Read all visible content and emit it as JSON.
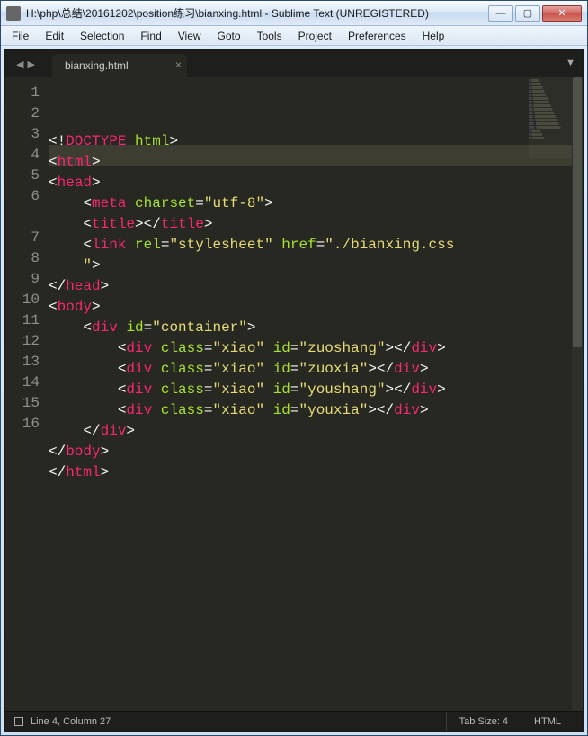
{
  "window": {
    "title": "H:\\php\\总结\\20161202\\position练习\\bianxing.html - Sublime Text (UNREGISTERED)"
  },
  "menu": {
    "items": [
      "File",
      "Edit",
      "Selection",
      "Find",
      "View",
      "Goto",
      "Tools",
      "Project",
      "Preferences",
      "Help"
    ]
  },
  "tabs": {
    "nav_back": "◀",
    "nav_fwd": "▶",
    "dropdown": "▼",
    "active": {
      "label": "bianxing.html",
      "close": "×"
    }
  },
  "editor": {
    "highlight_line": 4,
    "lines": [
      [
        {
          "t": "<!",
          "c": "p"
        },
        {
          "t": "DOCTYPE",
          "c": "tg"
        },
        {
          "t": " ",
          "c": "p"
        },
        {
          "t": "html",
          "c": "attr"
        },
        {
          "t": ">",
          "c": "p"
        }
      ],
      [
        {
          "t": "<",
          "c": "p"
        },
        {
          "t": "html",
          "c": "tg"
        },
        {
          "t": ">",
          "c": "p"
        }
      ],
      [
        {
          "t": "<",
          "c": "p"
        },
        {
          "t": "head",
          "c": "tg"
        },
        {
          "t": ">",
          "c": "p"
        }
      ],
      [
        {
          "t": "    <",
          "c": "p"
        },
        {
          "t": "meta",
          "c": "tg"
        },
        {
          "t": " ",
          "c": "p"
        },
        {
          "t": "charset",
          "c": "attr"
        },
        {
          "t": "=",
          "c": "p"
        },
        {
          "t": "\"utf-8\"",
          "c": "str"
        },
        {
          "t": ">",
          "c": "p"
        }
      ],
      [
        {
          "t": "    <",
          "c": "p"
        },
        {
          "t": "title",
          "c": "tg"
        },
        {
          "t": "></",
          "c": "p"
        },
        {
          "t": "title",
          "c": "tg"
        },
        {
          "t": ">",
          "c": "p"
        }
      ],
      [
        {
          "t": "    <",
          "c": "p"
        },
        {
          "t": "link",
          "c": "tg"
        },
        {
          "t": " ",
          "c": "p"
        },
        {
          "t": "rel",
          "c": "attr"
        },
        {
          "t": "=",
          "c": "p"
        },
        {
          "t": "\"stylesheet\"",
          "c": "str"
        },
        {
          "t": " ",
          "c": "p"
        },
        {
          "t": "href",
          "c": "attr"
        },
        {
          "t": "=",
          "c": "p"
        },
        {
          "t": "\"./bianxing.css",
          "c": "str"
        }
      ],
      [
        {
          "t": "    ",
          "c": "p"
        },
        {
          "t": "\"",
          "c": "str"
        },
        {
          "t": ">",
          "c": "p"
        }
      ],
      [
        {
          "t": "</",
          "c": "p"
        },
        {
          "t": "head",
          "c": "tg"
        },
        {
          "t": ">",
          "c": "p"
        }
      ],
      [
        {
          "t": "<",
          "c": "p"
        },
        {
          "t": "body",
          "c": "tg"
        },
        {
          "t": ">",
          "c": "p"
        }
      ],
      [
        {
          "t": "    <",
          "c": "p"
        },
        {
          "t": "div",
          "c": "tg"
        },
        {
          "t": " ",
          "c": "p"
        },
        {
          "t": "id",
          "c": "attr"
        },
        {
          "t": "=",
          "c": "p"
        },
        {
          "t": "\"container\"",
          "c": "str"
        },
        {
          "t": ">",
          "c": "p"
        }
      ],
      [
        {
          "t": "        <",
          "c": "p"
        },
        {
          "t": "div",
          "c": "tg"
        },
        {
          "t": " ",
          "c": "p"
        },
        {
          "t": "class",
          "c": "attr"
        },
        {
          "t": "=",
          "c": "p"
        },
        {
          "t": "\"xiao\"",
          "c": "str"
        },
        {
          "t": " ",
          "c": "p"
        },
        {
          "t": "id",
          "c": "attr"
        },
        {
          "t": "=",
          "c": "p"
        },
        {
          "t": "\"zuoshang\"",
          "c": "str"
        },
        {
          "t": "></",
          "c": "p"
        },
        {
          "t": "div",
          "c": "tg"
        },
        {
          "t": ">",
          "c": "p"
        }
      ],
      [
        {
          "t": "        <",
          "c": "p"
        },
        {
          "t": "div",
          "c": "tg"
        },
        {
          "t": " ",
          "c": "p"
        },
        {
          "t": "class",
          "c": "attr"
        },
        {
          "t": "=",
          "c": "p"
        },
        {
          "t": "\"xiao\"",
          "c": "str"
        },
        {
          "t": " ",
          "c": "p"
        },
        {
          "t": "id",
          "c": "attr"
        },
        {
          "t": "=",
          "c": "p"
        },
        {
          "t": "\"zuoxia\"",
          "c": "str"
        },
        {
          "t": "></",
          "c": "p"
        },
        {
          "t": "div",
          "c": "tg"
        },
        {
          "t": ">",
          "c": "p"
        }
      ],
      [
        {
          "t": "        <",
          "c": "p"
        },
        {
          "t": "div",
          "c": "tg"
        },
        {
          "t": " ",
          "c": "p"
        },
        {
          "t": "class",
          "c": "attr"
        },
        {
          "t": "=",
          "c": "p"
        },
        {
          "t": "\"xiao\"",
          "c": "str"
        },
        {
          "t": " ",
          "c": "p"
        },
        {
          "t": "id",
          "c": "attr"
        },
        {
          "t": "=",
          "c": "p"
        },
        {
          "t": "\"youshang\"",
          "c": "str"
        },
        {
          "t": "></",
          "c": "p"
        },
        {
          "t": "div",
          "c": "tg"
        },
        {
          "t": ">",
          "c": "p"
        }
      ],
      [
        {
          "t": "        <",
          "c": "p"
        },
        {
          "t": "div",
          "c": "tg"
        },
        {
          "t": " ",
          "c": "p"
        },
        {
          "t": "class",
          "c": "attr"
        },
        {
          "t": "=",
          "c": "p"
        },
        {
          "t": "\"xiao\"",
          "c": "str"
        },
        {
          "t": " ",
          "c": "p"
        },
        {
          "t": "id",
          "c": "attr"
        },
        {
          "t": "=",
          "c": "p"
        },
        {
          "t": "\"youxia\"",
          "c": "str"
        },
        {
          "t": "></",
          "c": "p"
        },
        {
          "t": "div",
          "c": "tg"
        },
        {
          "t": ">",
          "c": "p"
        }
      ],
      [
        {
          "t": "    </",
          "c": "p"
        },
        {
          "t": "div",
          "c": "tg"
        },
        {
          "t": ">",
          "c": "p"
        }
      ],
      [
        {
          "t": "</",
          "c": "p"
        },
        {
          "t": "body",
          "c": "tg"
        },
        {
          "t": ">",
          "c": "p"
        }
      ],
      [
        {
          "t": "</",
          "c": "p"
        },
        {
          "t": "html",
          "c": "tg"
        },
        {
          "t": ">",
          "c": "p"
        }
      ]
    ],
    "gutter_numbers": [
      "1",
      "2",
      "3",
      "4",
      "5",
      "6",
      "",
      "7",
      "8",
      "9",
      "10",
      "11",
      "12",
      "13",
      "14",
      "15",
      "16"
    ]
  },
  "status": {
    "position": "Line 4, Column 27",
    "tab_size": "Tab Size: 4",
    "syntax": "HTML"
  }
}
